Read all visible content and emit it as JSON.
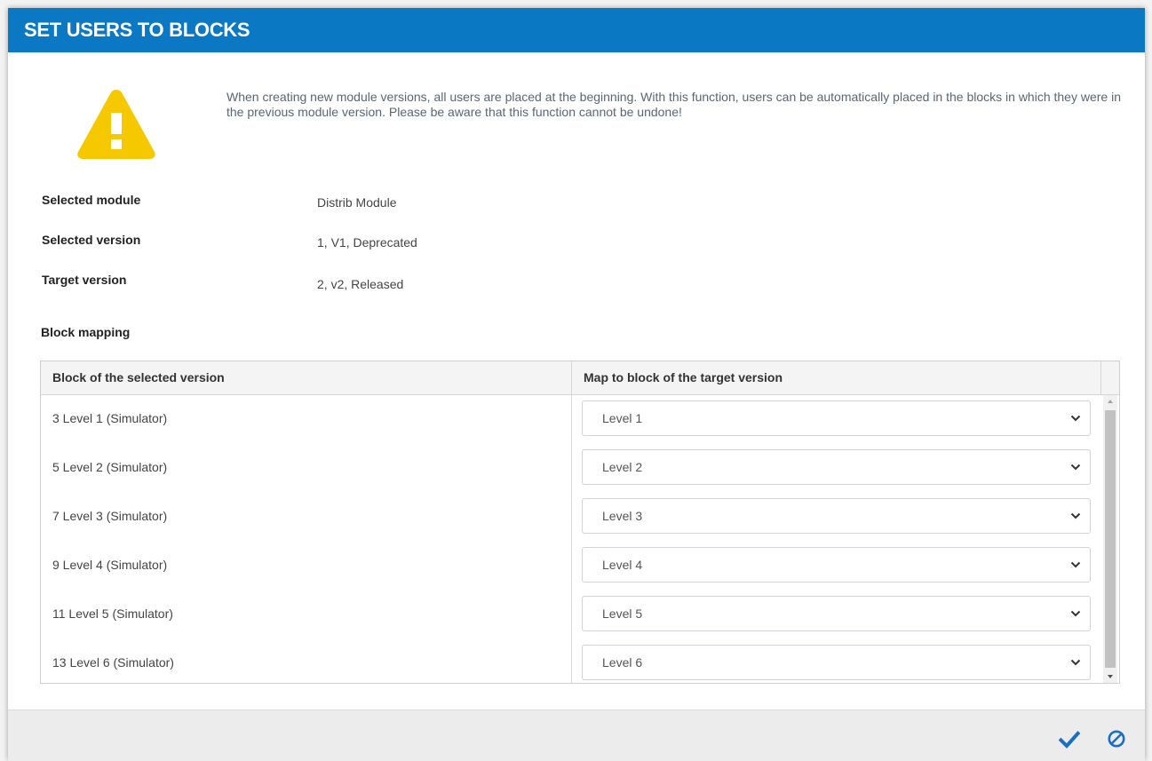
{
  "dialog": {
    "title": "SET USERS TO BLOCKS",
    "warning_text": "When creating new module versions, all users are placed at the beginning. With this function, users can be automatically placed in the blocks in which they were in the previous module version. Please be aware that this function cannot be undone!"
  },
  "info": {
    "selected_module_label": "Selected module",
    "selected_module_value": "Distrib Module",
    "selected_version_label": "Selected version",
    "selected_version_value": "1, V1, Deprecated",
    "target_version_label": "Target version",
    "target_version_value": "2, v2, Released"
  },
  "mapping": {
    "section_label": "Block mapping",
    "columns": [
      "Block of the selected version",
      "Map to block of the target version"
    ],
    "rows": [
      {
        "source": "3 Level 1 (Simulator)",
        "target": "Level 1"
      },
      {
        "source": "5 Level 2 (Simulator)",
        "target": "Level 2"
      },
      {
        "source": "7 Level 3 (Simulator)",
        "target": "Level 3"
      },
      {
        "source": "9 Level 4 (Simulator)",
        "target": "Level 4"
      },
      {
        "source": "11 Level 5 (Simulator)",
        "target": "Level 5"
      },
      {
        "source": "13 Level 6 (Simulator)",
        "target": "Level 6"
      }
    ]
  },
  "footer": {
    "confirm_icon": "checkmark-icon",
    "cancel_icon": "cancel-circle-slash-icon"
  },
  "colors": {
    "title_bar": "#0a78c2",
    "accent_icon": "#1a6fc4",
    "warning_yellow": "#f6c800"
  }
}
